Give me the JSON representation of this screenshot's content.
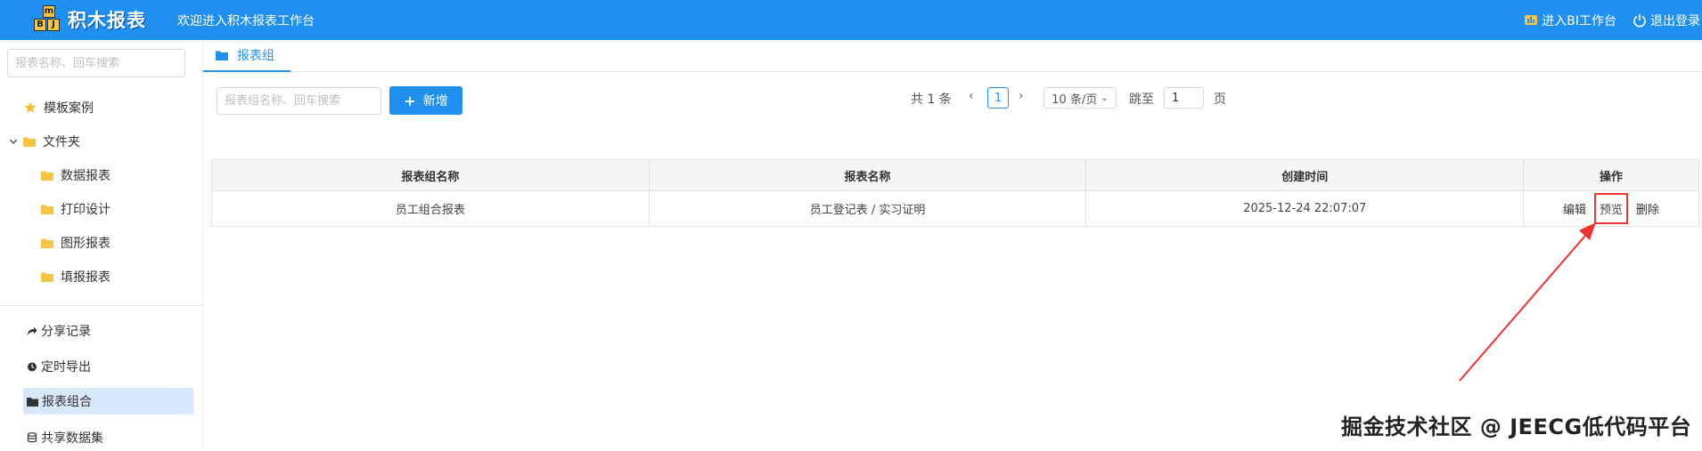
{
  "header": {
    "logo_letters": [
      "m",
      "B",
      "J"
    ],
    "logo_text": "积木报表",
    "welcome": "欢迎进入积木报表工作台",
    "bi_link": "进入BI工作台",
    "logout": "退出登录",
    "bg_color": "#1f8ff0"
  },
  "sidebar": {
    "search_placeholder": "报表名称、回车搜索",
    "tree": [
      {
        "label": "模板案例",
        "icon": "star-icon"
      },
      {
        "label": "文件夹",
        "icon": "folder-icon",
        "expanded": true
      },
      {
        "label": "数据报表",
        "icon": "folder-icon"
      },
      {
        "label": "打印设计",
        "icon": "folder-icon"
      },
      {
        "label": "图形报表",
        "icon": "folder-icon"
      },
      {
        "label": "填报报表",
        "icon": "folder-icon"
      }
    ],
    "menu": [
      {
        "label": "分享记录",
        "icon": "share-icon"
      },
      {
        "label": "定时导出",
        "icon": "timer-icon"
      },
      {
        "label": "报表组合",
        "icon": "folder-icon",
        "active": true
      },
      {
        "label": "共享数据集",
        "icon": "database-icon"
      }
    ]
  },
  "tabs": [
    {
      "label": "报表组",
      "active": true
    }
  ],
  "toolbar": {
    "search_placeholder": "报表组名称、回车搜索",
    "add_label": "新增"
  },
  "pagination": {
    "total": "共 1 条",
    "current": "1",
    "page_size": "10 条/页",
    "jump_label": "跳至",
    "jump_value": "1",
    "page_label": "页"
  },
  "table": {
    "headers": [
      "报表组名称",
      "报表名称",
      "创建时间",
      "操作"
    ],
    "rows": [
      {
        "group_name": "员工组合报表",
        "report_names": "员工登记表 / 实习证明",
        "created": "2025-12-24 22:07:07",
        "actions": [
          "编辑",
          "预览",
          "删除"
        ]
      }
    ]
  },
  "watermark": "掘金技术社区 @ JEECG低代码平台",
  "annotation_color": "#e33"
}
